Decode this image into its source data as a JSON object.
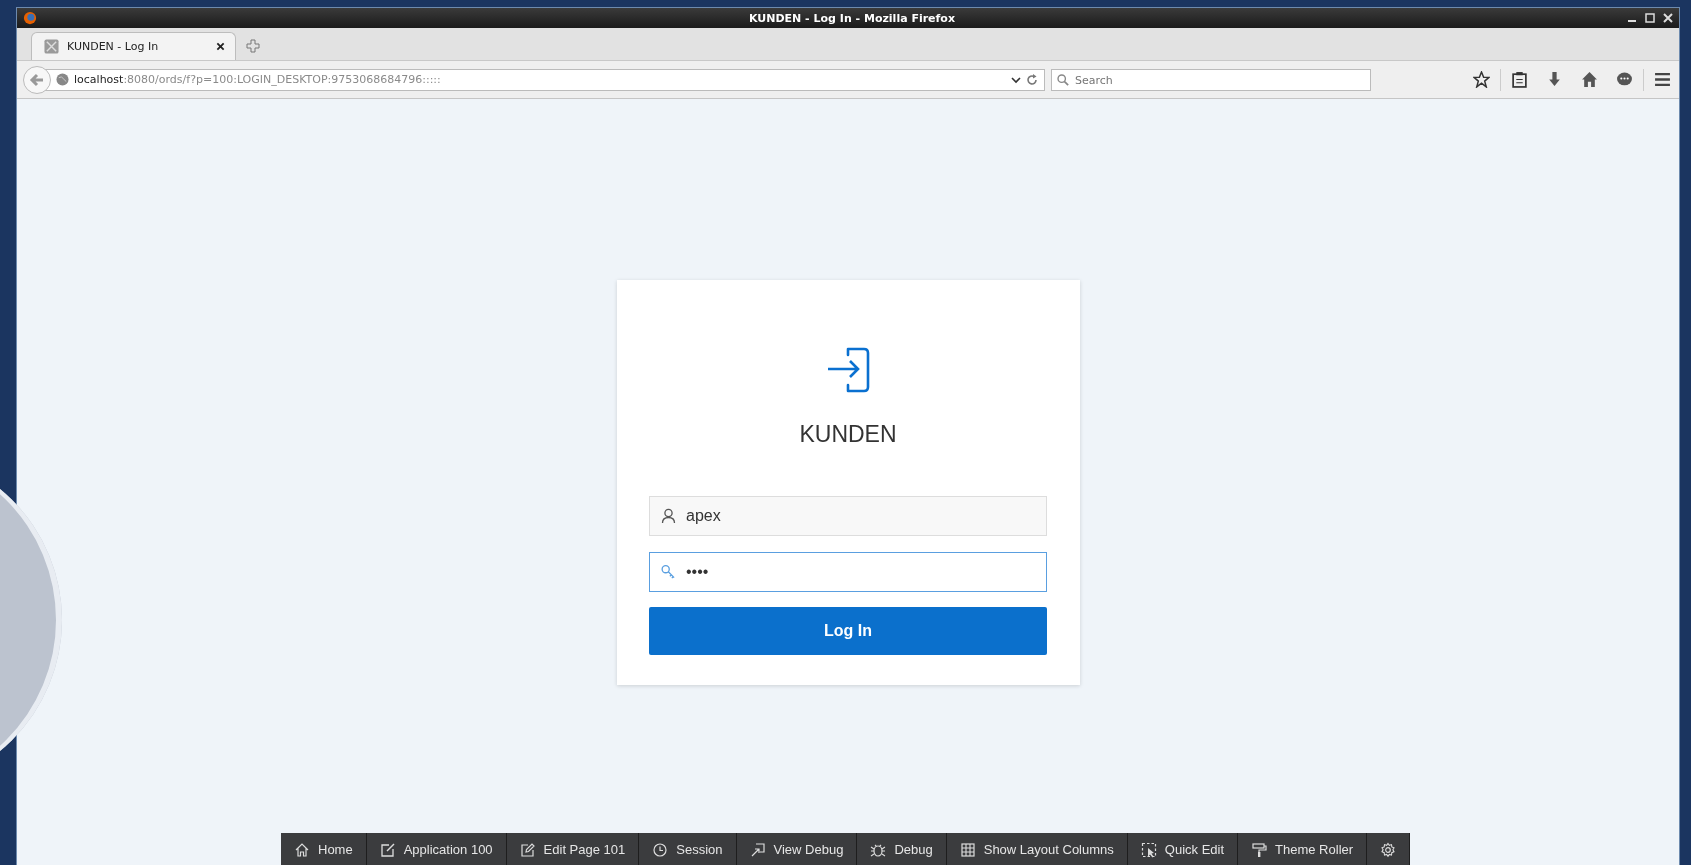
{
  "window": {
    "title": "KUNDEN - Log In - Mozilla Firefox"
  },
  "tabs": [
    {
      "label": "KUNDEN - Log In",
      "selected": true
    }
  ],
  "address_bar": {
    "host": "localhost",
    "path": ":8080/ords/f?p=100:LOGIN_DESKTOP:9753068684796:::::"
  },
  "search": {
    "placeholder": "Search"
  },
  "login": {
    "title": "KUNDEN",
    "username": "apex",
    "password": "••••",
    "password_focused": true,
    "button": "Log In"
  },
  "dev_toolbar": [
    {
      "kind": "home",
      "label": "Home"
    },
    {
      "kind": "application",
      "label": "Application 100"
    },
    {
      "kind": "edit",
      "label": "Edit Page 101"
    },
    {
      "kind": "session",
      "label": "Session"
    },
    {
      "kind": "view-debug",
      "label": "View Debug"
    },
    {
      "kind": "debug",
      "label": "Debug"
    },
    {
      "kind": "layout",
      "label": "Show Layout Columns"
    },
    {
      "kind": "quick-edit",
      "label": "Quick Edit"
    },
    {
      "kind": "theme",
      "label": "Theme Roller"
    },
    {
      "kind": "settings"
    }
  ]
}
